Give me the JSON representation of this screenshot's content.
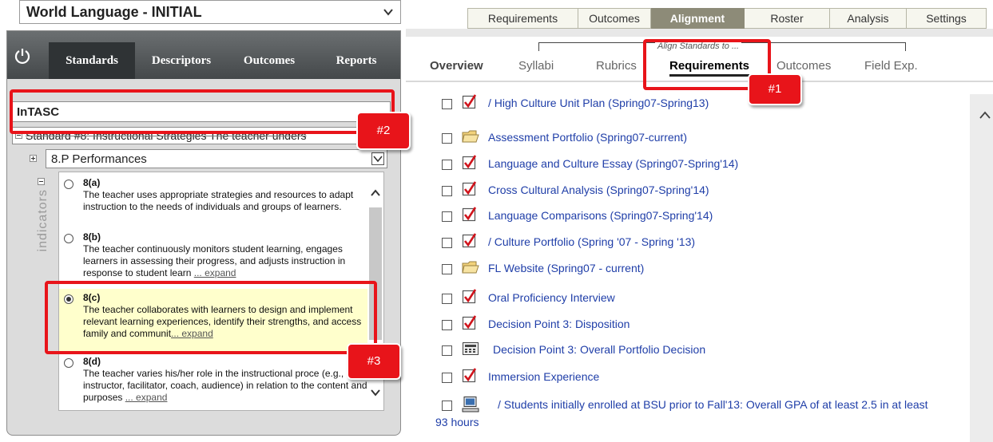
{
  "program": {
    "title": "World Language - INITIAL"
  },
  "main_tabs": [
    {
      "label": "Requirements"
    },
    {
      "label": "Outcomes"
    },
    {
      "label": "Alignment",
      "active": true
    },
    {
      "label": "Roster"
    },
    {
      "label": "Analysis"
    },
    {
      "label": "Settings"
    }
  ],
  "left_tabs": [
    {
      "label": "Standards",
      "active": true
    },
    {
      "label": "Descriptors"
    },
    {
      "label": "Outcomes"
    },
    {
      "label": "Reports"
    }
  ],
  "standards": {
    "set_name": "InTASC",
    "standard_row": "Standard #8: Instructional Strategies The teacher unders",
    "performance_select": "8.P Performances",
    "indicators_label": "indicators",
    "expand_label": "... expand",
    "items": [
      {
        "code": "8(a)",
        "text": "The teacher uses appropriate strategies and resources to adapt instruction to the needs of individuals and groups of learners."
      },
      {
        "code": "8(b)",
        "text": "The teacher continuously monitors student learning, engages learners in assessing their progress, and adjusts instruction in response to student learn"
      },
      {
        "code": "8(c)",
        "text": "The teacher collaborates with learners to design and implement relevant learning experiences, identify their strengths, and access family and communit",
        "selected": true
      },
      {
        "code": "8(d)",
        "text": "The teacher varies his/her role in the instructional proce (e.g., instructor, facilitator, coach, audience) in relation to the content and purposes"
      }
    ]
  },
  "subnav": {
    "caption": "Align Standards to ...",
    "tabs": [
      {
        "label": "Overview"
      },
      {
        "label": "Syllabi"
      },
      {
        "label": "Rubrics"
      },
      {
        "label": "Requirements",
        "active": true
      },
      {
        "label": "Outcomes"
      },
      {
        "label": "Field Exp."
      }
    ]
  },
  "requirements": [
    {
      "title": "/ High Culture Unit Plan (Spring07-Spring13)",
      "icon": "checkbox-icon"
    },
    {
      "title": "Assessment Portfolio (Spring07-current)",
      "icon": "folder-icon"
    },
    {
      "title": "Language and Culture Essay (Spring07-Spring'14)",
      "icon": "checkbox-icon"
    },
    {
      "title": "Cross Cultural Analysis (Spring07-Spring'14)",
      "icon": "checkbox-icon"
    },
    {
      "title": "Language Comparisons (Spring07-Spring'14)",
      "icon": "checkbox-icon"
    },
    {
      "title": "/ Culture Portfolio (Spring '07 - Spring '13)",
      "icon": "checkbox-icon"
    },
    {
      "title": "FL Website (Spring07 - current)",
      "icon": "folder-icon"
    },
    {
      "title": "Oral Proficiency Interview",
      "icon": "checkbox-icon"
    },
    {
      "title": "Decision Point 3: Disposition",
      "icon": "checkbox-icon"
    },
    {
      "title": "Decision Point 3: Overall Portfolio Decision",
      "icon": "calculator-icon"
    },
    {
      "title": "Immersion Experience",
      "icon": "checkbox-icon"
    },
    {
      "title": "/ Students initially enrolled at BSU prior to Fall'13: Overall GPA of at least 2.5 in at least",
      "icon": "computer-icon"
    }
  ],
  "requirement_continuation": "93 hours",
  "callouts": [
    {
      "label": "#1"
    },
    {
      "label": "#2"
    },
    {
      "label": "#3"
    }
  ],
  "colors": {
    "callout": "#e8141a",
    "link": "#1f3ea8",
    "active_tab": "#8d8b78"
  }
}
